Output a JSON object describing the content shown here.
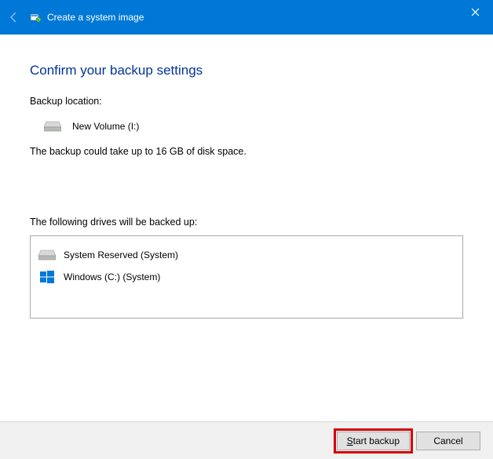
{
  "titlebar": {
    "title": "Create a system image"
  },
  "heading": "Confirm your backup settings",
  "backup_location_label": "Backup location:",
  "backup_location": "New Volume (I:)",
  "size_notice": "The backup could take up to 16 GB of disk space.",
  "drives_label": "The following drives will be backed up:",
  "drives": [
    {
      "label": "System Reserved (System)"
    },
    {
      "label": "Windows (C:) (System)"
    }
  ],
  "buttons": {
    "start": "Start backup",
    "cancel": "Cancel"
  }
}
